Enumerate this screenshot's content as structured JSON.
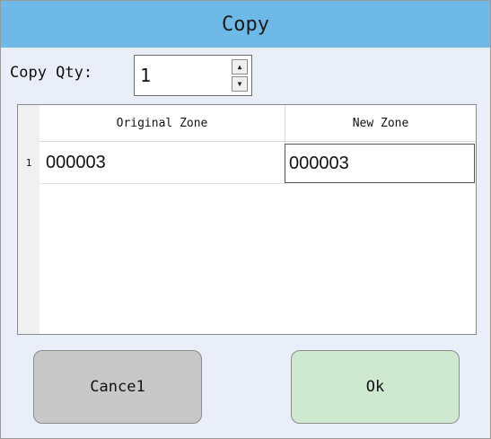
{
  "window": {
    "title": "Copy"
  },
  "copy_qty": {
    "label": "Copy Qty:",
    "value": "1",
    "spin_up": "▲",
    "spin_down": "▼"
  },
  "table": {
    "columns": [
      "Original Zone",
      "New Zone"
    ],
    "rows": [
      {
        "row_number": "1",
        "original_zone": "000003",
        "new_zone": "000003"
      }
    ]
  },
  "buttons": {
    "cancel_label": "Cance1",
    "ok_label": "Ok"
  },
  "colors": {
    "title_bar": "#6fb9e8",
    "dialog_bg": "#e9eef8",
    "cancel_button": "#c8c8c8",
    "ok_button": "#cfe8d0"
  }
}
